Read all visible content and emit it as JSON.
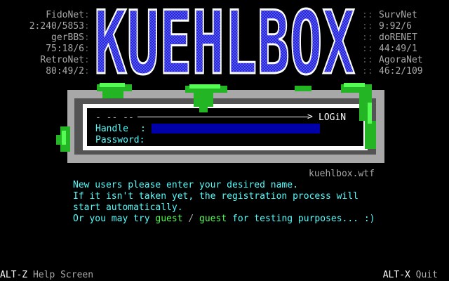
{
  "nodes_left": [
    {
      "label": "FidoNet",
      "sep": "::"
    },
    {
      "label": "2:240/5853",
      "sep": "::"
    },
    {
      "label": "gerBBS",
      "sep": "::"
    },
    {
      "label": "75:18/6",
      "sep": "::"
    },
    {
      "label": "RetroNet",
      "sep": "::"
    },
    {
      "label": "80:49/2",
      "sep": "::"
    }
  ],
  "nodes_right": [
    {
      "label": "SurvNet",
      "sep": "::"
    },
    {
      "label": "9:92/6",
      "sep": "::"
    },
    {
      "label": "doRENET",
      "sep": "::"
    },
    {
      "label": "44:49/1",
      "sep": "::"
    },
    {
      "label": "AgoraNet",
      "sep": "::"
    },
    {
      "label": "46:2/109",
      "sep": "::"
    }
  ],
  "logo": {
    "text": "KUEHLBOX"
  },
  "login": {
    "header_dashes": "- -- --",
    "header_title": "LOGiN",
    "handle_label": "Handle",
    "handle_colon": ":",
    "handle_value": "",
    "password_label": "Password:",
    "password_value": ""
  },
  "host": "kuehlbox.wtf",
  "messages": {
    "line1": "New users please enter your desired name.",
    "line2": "If it isn't taken yet, the registration process will",
    "line3": "start automatically.",
    "line4_prefix": "Or you may try ",
    "line4_user": "guest",
    "line4_slash": " / ",
    "line4_pass": "guest",
    "line4_suffix": " for testing purposes... :)"
  },
  "footer": {
    "left_key": "ALT-Z",
    "left_label": " Help Screen",
    "right_key": "ALT-X",
    "right_label": " Quit"
  },
  "colors": {
    "background": "#000000",
    "cyan": "#54fcfc",
    "green": "#54fc54",
    "input_blue": "#0000a8",
    "logo_blue": "#5454fc",
    "slime_green": "#24b524"
  },
  "icons": [
    "arrow-right-icon",
    "slime-drip-icon"
  ]
}
